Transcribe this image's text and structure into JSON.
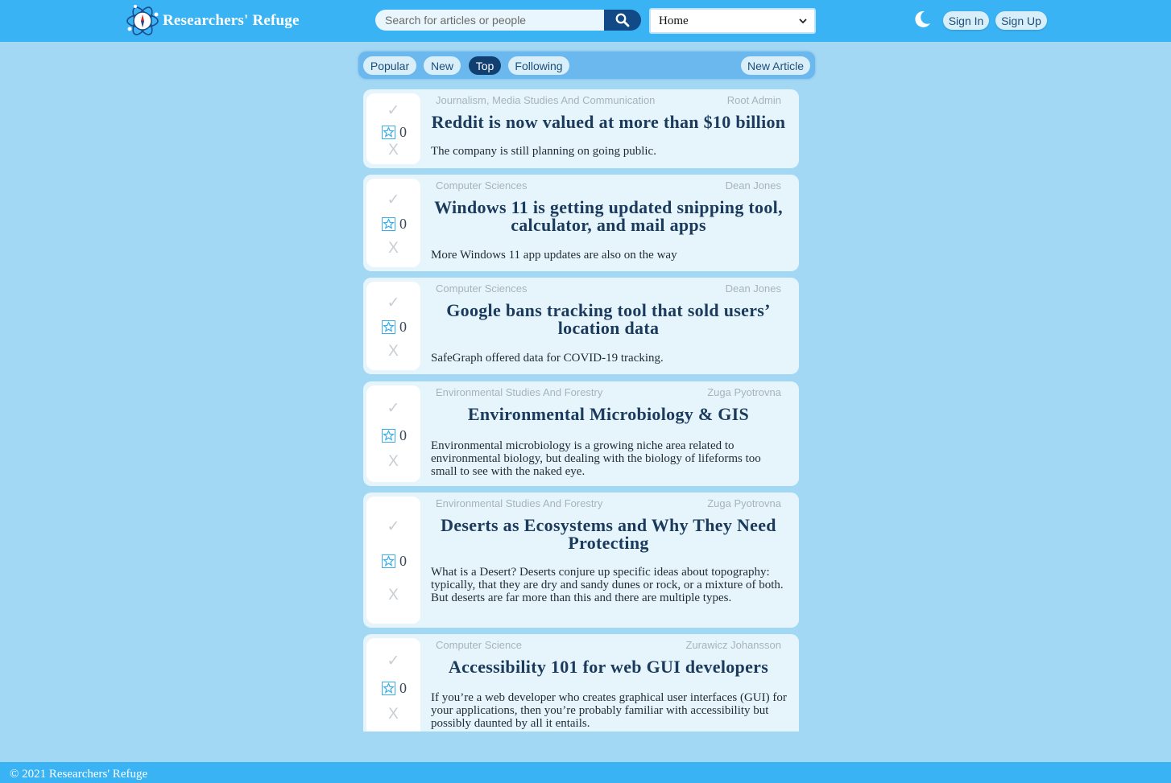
{
  "header": {
    "brand": "Researchers' Refuge",
    "search_placeholder": "Search for articles or people",
    "select_value": "Home",
    "sign_in": "Sign In",
    "sign_up": "Sign Up"
  },
  "tabs": {
    "popular": "Popular",
    "new": "New",
    "top": "Top",
    "following": "Following",
    "new_article": "New Article",
    "active": "Top"
  },
  "articles": [
    {
      "category": "Journalism, Media Studies And Communication",
      "author": "Root Admin",
      "title": "Reddit is now valued at more than $10 billion",
      "description": "The company is still planning on going public.",
      "score": "0"
    },
    {
      "category": "Computer Sciences",
      "author": "Dean Jones",
      "title": "Windows 11 is getting updated snipping tool, calculator, and mail apps",
      "description": "More Windows 11 app updates are also on the way",
      "score": "0"
    },
    {
      "category": "Computer Sciences",
      "author": "Dean Jones",
      "title": "Google bans tracking tool that sold users’ location data",
      "description": "SafeGraph offered data for COVID-19 tracking.",
      "score": "0"
    },
    {
      "category": "Environmental Studies And Forestry",
      "author": "Zuga Pyotrovna",
      "title": "Environmental Microbiology & GIS",
      "description": "Environmental microbiology is a growing niche area related to environmental biology, but dealing with the biology of lifeforms too small to see with the naked eye.",
      "score": "0"
    },
    {
      "category": "Environmental Studies And Forestry",
      "author": "Zuga Pyotrovna",
      "title": "Deserts as Ecosystems and Why They Need Protecting",
      "description": "What is a Desert? Deserts conjure up specific ideas about topography: typically, that they are dry and sandy dunes or rock, or a mixture of both. But deserts are far more than this and there are multiple types.",
      "score": "0"
    },
    {
      "category": "Computer Science",
      "author": "Zurawicz Johansson",
      "title": "Accessibility 101 for web GUI developers",
      "description": "If you’re a web developer who creates graphical user interfaces (GUI) for your applications, then you’re probably familiar with accessibility but possibly daunted by all it entails.",
      "score": "0"
    }
  ],
  "vote": {
    "up_glyph": "✓",
    "down_glyph": "X"
  },
  "footer": {
    "text": "© 2021 Researchers' Refuge"
  },
  "colors": {
    "page_bg": "#a3d8f4",
    "header_bg": "#3ab3f5",
    "card_bg": "#e6f5fc",
    "title_text": "#1b3a5c",
    "active_tab": "#113f70",
    "search_button": "#114a86",
    "star": "#3aaee8"
  },
  "icons": {
    "logo": "atom-compass-logo",
    "search": "search-icon",
    "dropdown": "chevron-down-icon",
    "theme": "moon-icon",
    "favorite": "star-icon",
    "upvote": "check-icon",
    "downvote": "x-icon"
  }
}
